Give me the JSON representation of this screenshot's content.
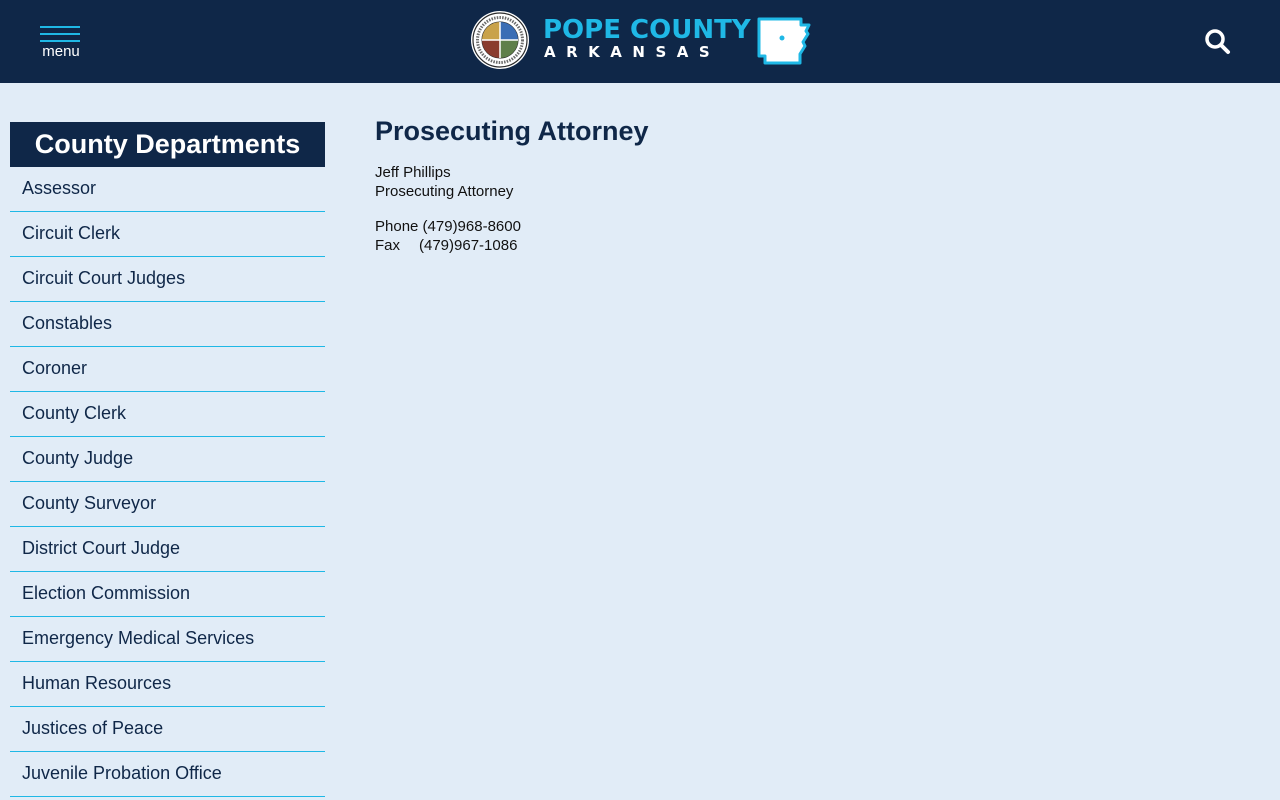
{
  "header": {
    "menu_label": "menu",
    "brand_title": "POPE COUNTY",
    "brand_subtitle": "ARKANSAS",
    "seal_text": "WELCOME TO POPE COUNTY ARKANSAS",
    "colors": {
      "navy": "#0f2748",
      "accent": "#1fb8e6"
    },
    "icons": [
      "hamburger-menu-icon",
      "county-seal-logo",
      "arkansas-state-icon",
      "search-icon"
    ]
  },
  "sidebar": {
    "title": "County Departments",
    "items": [
      "Assessor",
      "Circuit Clerk",
      "Circuit Court Judges",
      "Constables",
      "Coroner",
      "County Clerk",
      "County Judge",
      "County Surveyor",
      "District Court Judge",
      "Election Commission",
      "Emergency Medical Services",
      "Human Resources",
      "Justices of Peace",
      "Juvenile Probation Office"
    ]
  },
  "main": {
    "title": "Prosecuting Attorney",
    "name": "Jeff Phillips",
    "role": "Prosecuting Attorney",
    "phone_line": "Phone (479)968-8600",
    "fax_label": "Fax",
    "fax_number": "(479)967-1086"
  }
}
